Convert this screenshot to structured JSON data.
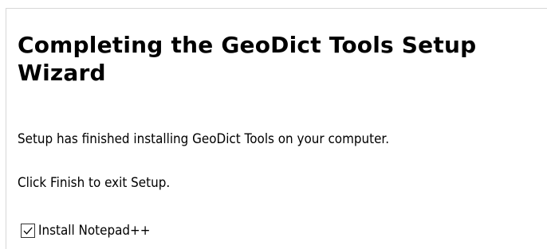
{
  "wizard": {
    "title": "Completing the GeoDict Tools Setup Wizard",
    "finished_message": "Setup has finished installing GeoDict Tools on your computer.",
    "exit_message": "Click Finish to exit Setup.",
    "checkbox": {
      "label": "Install Notepad++",
      "checked": true
    }
  },
  "colors": {
    "background": "#ffffff",
    "text": "#000000",
    "border": "#d7d7d7"
  }
}
